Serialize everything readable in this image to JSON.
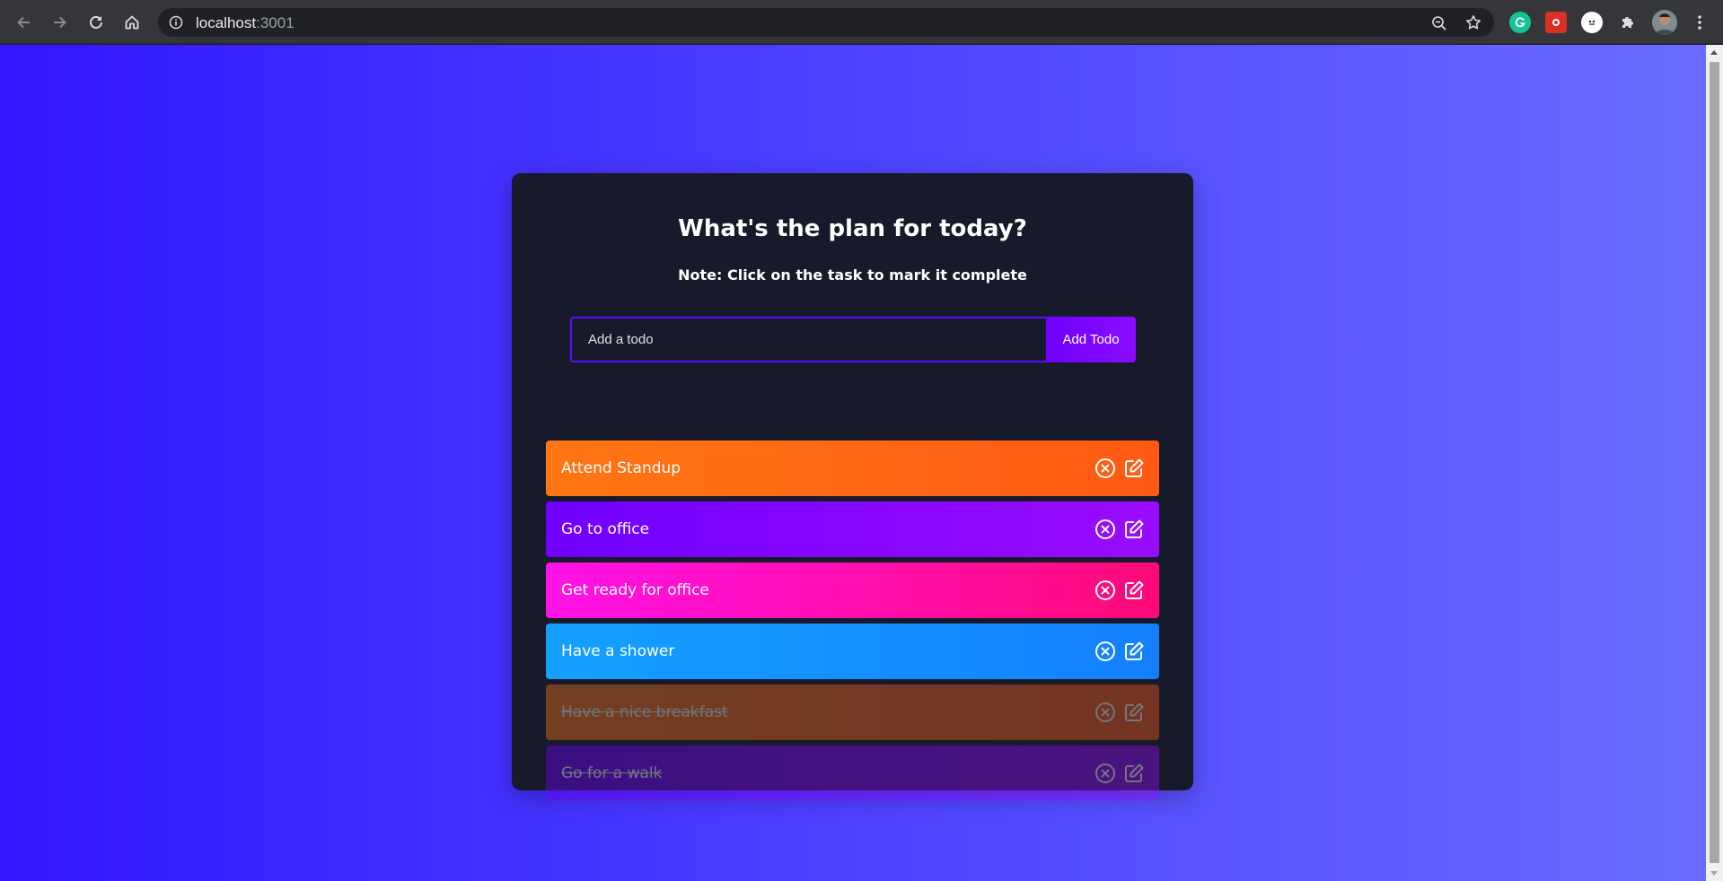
{
  "browser": {
    "url_host": "localhost",
    "url_port": ":3001",
    "icons": [
      "back-arrow-icon",
      "forward-arrow-icon",
      "reload-icon",
      "home-icon",
      "info-icon",
      "zoom-icon",
      "star-icon",
      "grammarly-extension-icon",
      "extension-icon-red",
      "extension-icon-face",
      "puzzle-extensions-icon",
      "profile-avatar",
      "more-vert-icon"
    ]
  },
  "app": {
    "title": "What's the plan for today?",
    "note": "Note: Click on the task to mark it complete",
    "input_placeholder": "Add a todo",
    "add_button_label": "Add Todo",
    "todos": [
      {
        "text": "Attend Standup",
        "complete": false,
        "color_from": "#ff7614",
        "color_to": "#ff5a14"
      },
      {
        "text": "Go to office",
        "complete": false,
        "color_from": "#7000ff",
        "color_to": "#9a0cff"
      },
      {
        "text": "Get ready for office",
        "complete": false,
        "color_from": "#ff12e7",
        "color_to": "#ff0a77"
      },
      {
        "text": "Have a shower",
        "complete": false,
        "color_from": "#14a0ff",
        "color_to": "#1480ff"
      },
      {
        "text": "Have a nice breakfast",
        "complete": true,
        "color_from": "#ff7614",
        "color_to": "#ff5a14"
      },
      {
        "text": "Go for a walk",
        "complete": true,
        "color_from": "#7000ff",
        "color_to": "#9a0cff"
      }
    ]
  },
  "colors": {
    "page_gradient_start": "#3216ff",
    "page_gradient_end": "#6a6cff",
    "card_background": "#161a2b",
    "accent": "#5d0cff"
  }
}
